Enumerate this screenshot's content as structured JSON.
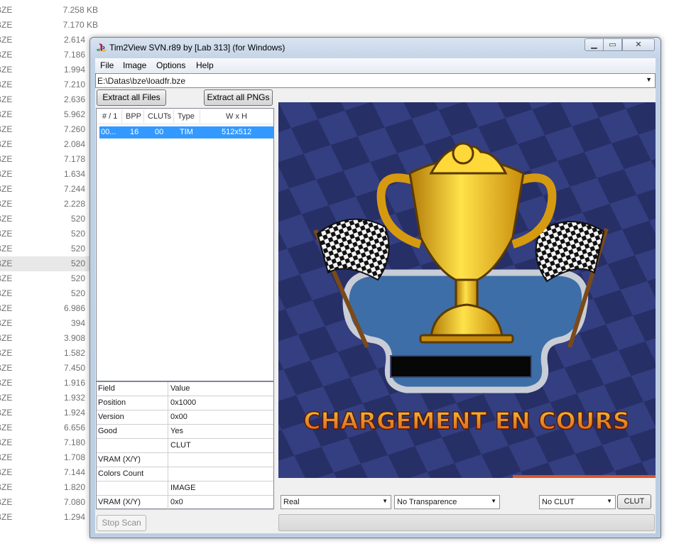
{
  "background_files": [
    {
      "ext": "BZE",
      "size": "7.258 KB"
    },
    {
      "ext": "BZE",
      "size": "7.170 KB"
    },
    {
      "ext": "BZE",
      "size": "2.614"
    },
    {
      "ext": "BZE",
      "size": "7.186"
    },
    {
      "ext": "BZE",
      "size": "1.994"
    },
    {
      "ext": "BZE",
      "size": "7.210"
    },
    {
      "ext": "BZE",
      "size": "2.636"
    },
    {
      "ext": "BZE",
      "size": "5.962"
    },
    {
      "ext": "BZE",
      "size": "7.260"
    },
    {
      "ext": "BZE",
      "size": "2.084"
    },
    {
      "ext": "BZE",
      "size": "7.178"
    },
    {
      "ext": "BZE",
      "size": "1.634"
    },
    {
      "ext": "BZE",
      "size": "7.244"
    },
    {
      "ext": "BZE",
      "size": "2.228"
    },
    {
      "ext": "BZE",
      "size": "520"
    },
    {
      "ext": "BZE",
      "size": "520"
    },
    {
      "ext": "BZE",
      "size": "520"
    },
    {
      "ext": "BZE",
      "size": "520"
    },
    {
      "ext": "BZE",
      "size": "520"
    },
    {
      "ext": "BZE",
      "size": "520"
    },
    {
      "ext": "BZE",
      "size": "6.986"
    },
    {
      "ext": "BZE",
      "size": "394"
    },
    {
      "ext": "BZE",
      "size": "3.908"
    },
    {
      "ext": "BZE",
      "size": "1.582"
    },
    {
      "ext": "BZE",
      "size": "7.450"
    },
    {
      "ext": "BZE",
      "size": "1.916"
    },
    {
      "ext": "BZE",
      "size": "1.932"
    },
    {
      "ext": "BZE",
      "size": "1.924"
    },
    {
      "ext": "BZE",
      "size": "6.656"
    },
    {
      "ext": "BZE",
      "size": "7.180"
    },
    {
      "ext": "BZE",
      "size": "1.708"
    },
    {
      "ext": "BZE",
      "size": "7.144"
    },
    {
      "ext": "BZE",
      "size": "1.820"
    },
    {
      "ext": "BZE",
      "size": "7.080"
    },
    {
      "ext": "BZE",
      "size": "1.294"
    }
  ],
  "window": {
    "title": "Tim2View SVN.r89 by [Lab 313] (for Windows)",
    "min_glyph": "▁",
    "max_glyph": "▭",
    "close_glyph": "✕"
  },
  "menu": [
    "File",
    "Image",
    "Options",
    "Help"
  ],
  "path": {
    "value": "E:\\Datas\\bze\\loadfr.bze",
    "arrow": "▼"
  },
  "buttons": {
    "extract_all_files": "Extract all Files",
    "extract_all_pngs": "Extract all PNGs",
    "stop_scan": "Stop Scan",
    "clut": "CLUT"
  },
  "file_list": {
    "columns": [
      "# / 1",
      "BPP",
      "CLUTs",
      "Type",
      "W x H"
    ],
    "rows": [
      {
        "num": "00...",
        "bpp": "16",
        "cluts": "00",
        "type": "TIM",
        "size": "512x512"
      }
    ]
  },
  "properties": [
    {
      "field": "Field",
      "value": "Value"
    },
    {
      "field": "Position",
      "value": "0x1000"
    },
    {
      "field": "Version",
      "value": "0x00"
    },
    {
      "field": "Good",
      "value": "Yes"
    },
    {
      "field": "",
      "value": "CLUT"
    },
    {
      "field": "VRAM (X/Y)",
      "value": ""
    },
    {
      "field": "Colors Count",
      "value": ""
    },
    {
      "field": "",
      "value": "IMAGE"
    },
    {
      "field": "VRAM (X/Y)",
      "value": "0x0"
    }
  ],
  "controls": {
    "mode": "Real",
    "transparence": "No Transparence",
    "clut_select": "No CLUT",
    "arrow": "▼"
  },
  "preview": {
    "caption": "CHARGEMENT EN COURS",
    "bg_color": "#262d66",
    "trophy_color": "#f2c31a",
    "caption_color": "#e8a21a"
  }
}
